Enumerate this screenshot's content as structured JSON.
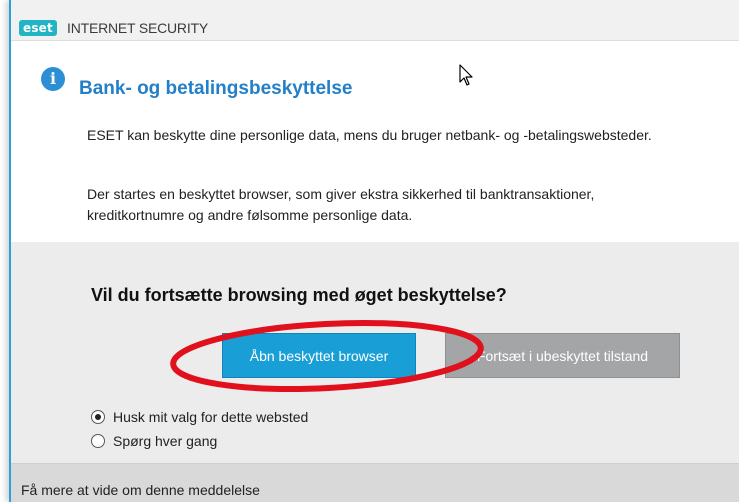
{
  "titlebar": {
    "logo_text": "eset",
    "product": "INTERNET SECURITY"
  },
  "header": {
    "icon": "info-icon",
    "title": "Bank- og betalingsbeskyttelse"
  },
  "body": {
    "paragraph1": "ESET kan beskytte dine personlige data, mens du bruger netbank- og -betalingswebsteder.",
    "paragraph2": "Der startes en beskyttet browser, som giver ekstra sikkerhed til banktransaktioner, kreditkortnumre og andre følsomme personlige data."
  },
  "prompt": {
    "question": "Vil du fortsætte browsing med øget beskyttelse?",
    "primary_button": "Åbn beskyttet browser",
    "secondary_button": "Fortsæt i ubeskyttet tilstand"
  },
  "options": [
    {
      "label": "Husk mit valg for dette websted",
      "checked": true
    },
    {
      "label": "Spørg hver gang",
      "checked": false
    }
  ],
  "footer": {
    "link": "Få mere at vide om denne meddelelse"
  },
  "colors": {
    "accent": "#2a9fd8",
    "primary_button": "#199ed6",
    "secondary_button": "#a3a5a7",
    "highlight_annotation": "#e0101c",
    "heading": "#2380c8"
  }
}
